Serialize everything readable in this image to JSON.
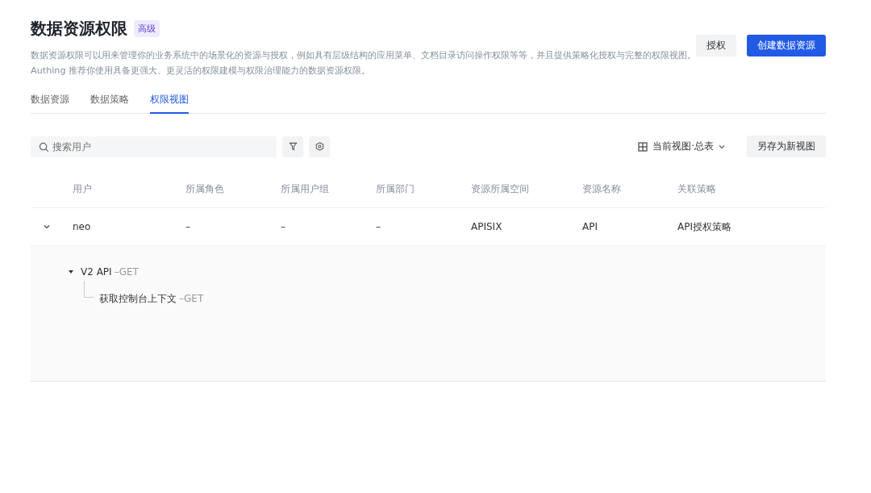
{
  "header": {
    "title": "数据资源权限",
    "badge": "高级",
    "description": "数据资源权限可以用来管理你的业务系统中的场景化的资源与授权，例如具有层级结构的应用菜单、文档目录访问操作权限等等，并且提供策略化授权与完整的权限视图。Authing 推荐你使用具备更强大、更灵活的权限建模与权限治理能力的数据资源权限。",
    "buttons": [
      {
        "label": "授权",
        "kind": "secondary"
      },
      {
        "label": "创建数据资源",
        "kind": "primary"
      }
    ]
  },
  "tabs": [
    {
      "label": "数据资源",
      "selected": false
    },
    {
      "label": "数据策略",
      "selected": false
    },
    {
      "label": "权限视图",
      "selected": true
    }
  ],
  "toolbar": {
    "search": {
      "placeholder": "搜索用户"
    },
    "view_selector": "当前视图·总表",
    "save_button": "另存为新视图"
  },
  "table": {
    "columns": [
      "用户",
      "所属角色",
      "所属用户组",
      "所属部门",
      "资源所属空间",
      "资源名称",
      "关联策略"
    ],
    "rows": [
      {
        "expanded": true,
        "cells": [
          "neo",
          "–",
          "–",
          "–",
          "APISIX",
          "API",
          "API授权策略"
        ],
        "tree": [
          {
            "name": "V2 API",
            "method": "–GET",
            "expanded": true,
            "children": [
              {
                "name": "获取控制台上下文",
                "method": "–GET"
              }
            ]
          }
        ]
      }
    ]
  }
}
